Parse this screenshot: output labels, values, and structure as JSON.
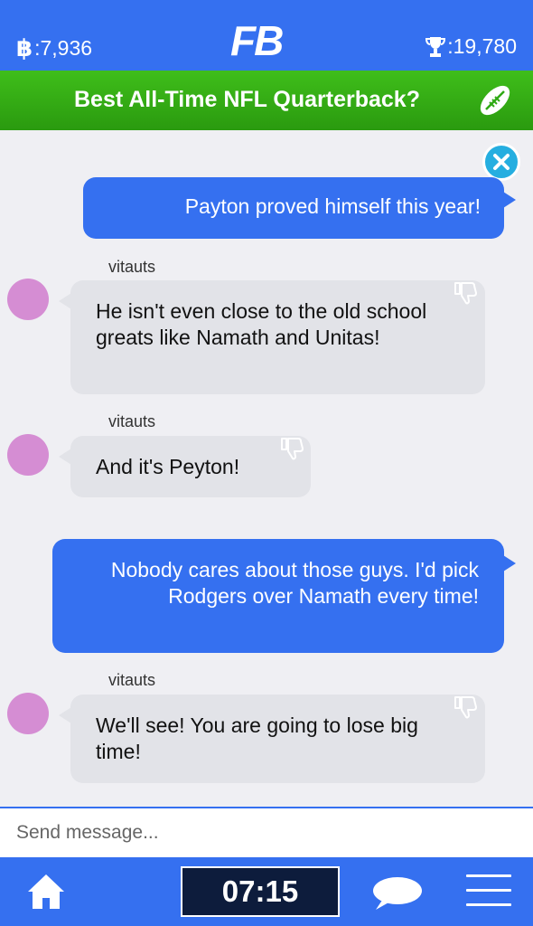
{
  "header": {
    "coins": ":7,936",
    "logo": "FB",
    "trophies": ":19,780"
  },
  "topic": {
    "title": "Best All-Time NFL Quarterback?"
  },
  "messages": [
    {
      "direction": "outgoing",
      "text": "Payton proved himself this year!"
    },
    {
      "direction": "incoming",
      "user": "vitauts",
      "text": "He isn't even close to the old school greats like Namath and Unitas!"
    },
    {
      "direction": "incoming",
      "user": "vitauts",
      "text": "And it's Peyton!"
    },
    {
      "direction": "outgoing",
      "text": "Nobody cares about those guys. I'd pick Rodgers over Namath every time!"
    },
    {
      "direction": "incoming",
      "user": "vitauts",
      "text": "We'll see! You are going to lose big time!"
    }
  ],
  "composer": {
    "placeholder": "Send message..."
  },
  "footer": {
    "timer": "07:15"
  },
  "colors": {
    "primary": "#3570f0",
    "topic_green": "#3fbe1a",
    "incoming_bubble": "#e2e3e8",
    "avatar": "#d58dd3",
    "close": "#25aee0",
    "timer_bg": "#0d1c3c"
  },
  "icons": [
    "bitcoin-icon",
    "trophy-icon",
    "football-icon",
    "close-icon",
    "thumbs-down-icon",
    "home-icon",
    "chat-icon",
    "menu-icon"
  ]
}
